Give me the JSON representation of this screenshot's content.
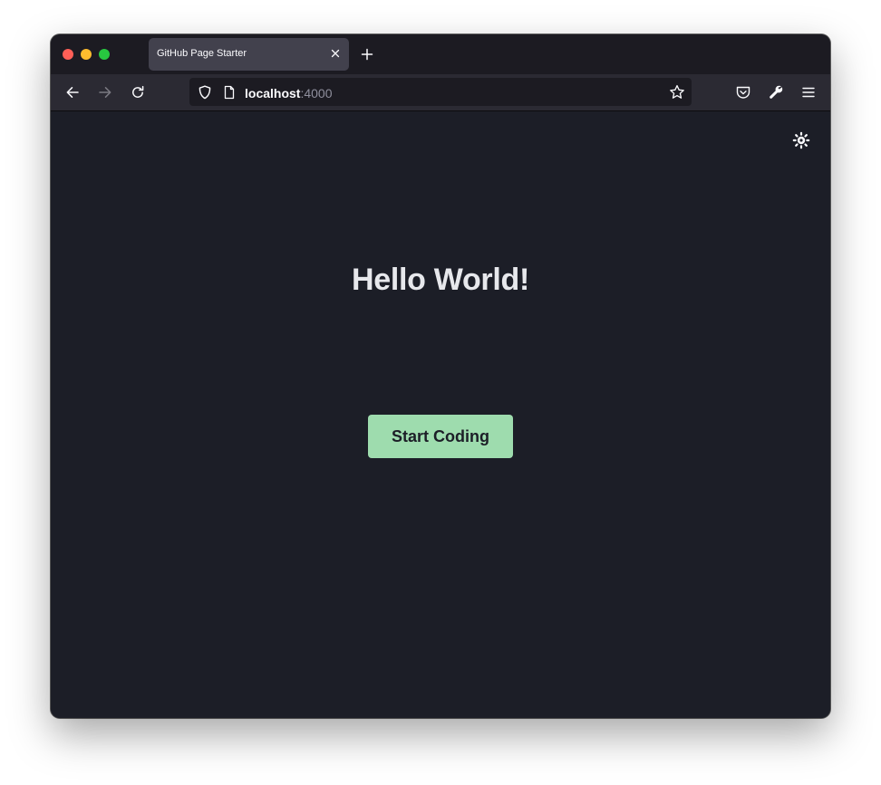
{
  "browser": {
    "tab": {
      "title": "GitHub Page Starter",
      "close_icon": "close-icon"
    },
    "new_tab_icon": "plus-icon",
    "nav": {
      "back_icon": "arrow-left-icon",
      "forward_icon": "arrow-right-icon",
      "reload_icon": "reload-icon"
    },
    "url": {
      "host": "localhost",
      "port": ":4000",
      "shield_icon": "shield-icon",
      "page_icon": "page-icon",
      "bookmark_icon": "star-icon"
    },
    "toolbar": {
      "pocket_icon": "pocket-icon",
      "tools_icon": "wrench-icon",
      "menu_icon": "hamburger-menu-icon"
    }
  },
  "page": {
    "heading": "Hello World!",
    "cta_label": "Start Coding",
    "theme_toggle_icon": "sun-icon"
  },
  "colors": {
    "page_background": "#1c1e27",
    "heading": "#e7e8ec",
    "cta_background": "#9edcae",
    "cta_text": "#1c1e27",
    "titlebar": "#1c1b22",
    "navbar": "#2b2a33",
    "active_tab": "#42414d"
  }
}
